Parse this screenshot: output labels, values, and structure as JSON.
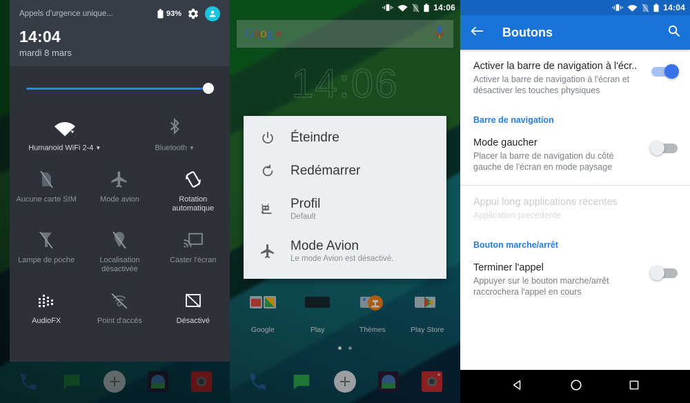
{
  "left_panel": {
    "statusbar": {
      "carrier": "Appels d'urgence unique...",
      "battery_pct": "93%"
    },
    "icons": {
      "battery": "battery-icon",
      "settings": "gear-icon",
      "avatar": "user-avatar-icon"
    },
    "clock": "14:04",
    "date": "mardi 8 mars",
    "brightness": {
      "name": "brightness-slider",
      "value": 100
    },
    "tiles": [
      {
        "label": "Humanoid WiFi 2-4",
        "icon": "wifi-icon",
        "active": true,
        "caret": true
      },
      {
        "label": "Bluetooth",
        "icon": "bluetooth-icon",
        "active": false,
        "caret": true
      },
      {
        "label": "Aucune carte SIM",
        "icon": "no-sim-icon",
        "active": false,
        "caret": false
      },
      {
        "label": "Mode avion",
        "icon": "airplane-icon",
        "active": false,
        "caret": false
      },
      {
        "label": "Rotation automatique",
        "icon": "auto-rotate-icon",
        "active": true,
        "caret": false
      },
      {
        "label": "Lampe de poche",
        "icon": "flashlight-off-icon",
        "active": false,
        "caret": false
      },
      {
        "label": "Localisation désactivée",
        "icon": "location-off-icon",
        "active": false,
        "caret": false
      },
      {
        "label": "Caster l'écran",
        "icon": "cast-icon",
        "active": false,
        "caret": false
      },
      {
        "label": "AudioFX",
        "icon": "equalizer-icon",
        "active": true,
        "caret": false
      },
      {
        "label": "Point d'accès",
        "icon": "hotspot-off-icon",
        "active": false,
        "caret": false
      },
      {
        "label": "Désactivé",
        "icon": "sync-off-icon",
        "active": true,
        "caret": false
      }
    ],
    "dock": [
      {
        "name": "phone-icon"
      },
      {
        "name": "messaging-icon"
      },
      {
        "name": "app-drawer-icon"
      },
      {
        "name": "gallery-icon"
      },
      {
        "name": "camera-icon"
      }
    ]
  },
  "mid_panel": {
    "statusbar": {
      "time": "14:06"
    },
    "search": {
      "logo": "Google",
      "mic": "microphone-icon"
    },
    "clock_widget": "14:06",
    "apps": [
      {
        "label": "Google",
        "icon": "google-folder-icon"
      },
      {
        "label": "Play",
        "icon": "play-folder-icon"
      },
      {
        "label": "Thèmes",
        "icon": "themes-icon"
      },
      {
        "label": "Play Store",
        "icon": "play-store-icon"
      }
    ],
    "page_dots": {
      "count": 2,
      "active_index": 0
    },
    "power_dialog": [
      {
        "title": "Éteindre",
        "sub": "",
        "icon": "power-icon"
      },
      {
        "title": "Redémarrer",
        "sub": "",
        "icon": "restart-icon"
      },
      {
        "title": "Profil",
        "sub": "Default",
        "icon": "cyanogenmod-icon"
      },
      {
        "title": "Mode Avion",
        "sub": "Le mode Avion est désactivé.",
        "icon": "airplane-icon"
      }
    ],
    "dock": [
      {
        "name": "phone-icon"
      },
      {
        "name": "messaging-icon"
      },
      {
        "name": "app-drawer-icon"
      },
      {
        "name": "gallery-icon"
      },
      {
        "name": "camera-icon"
      }
    ]
  },
  "right_panel": {
    "statusbar": {
      "time": "14:04"
    },
    "appbar": {
      "back": "back-arrow-icon",
      "title": "Boutons",
      "search": "search-icon"
    },
    "prefs": [
      {
        "title": "Activer la barre de navigation à l'écr..",
        "sum": "Activer la barre de navigation à l'écran et désactiver les touches physiques",
        "switch": "on",
        "disabled": false,
        "has_switch": true
      },
      {
        "title": "Mode gaucher",
        "sum": "Placer la barre de navigation du côté gauche de l'écran en mode paysage",
        "switch": "off",
        "disabled": false,
        "has_switch": true
      },
      {
        "title": "Appui long applications récentes",
        "sum": "Application précédente",
        "switch": "",
        "disabled": true,
        "has_switch": false
      },
      {
        "title": "Terminer l'appel",
        "sum": "Appuyer sur le bouton marche/arrêt raccrochera l'appel en cours",
        "switch": "off",
        "disabled": false,
        "has_switch": true
      }
    ],
    "categories": {
      "nav": "Barre de navigation",
      "power": "Bouton marche/arrêt"
    },
    "navbar": [
      {
        "name": "nav-back-icon"
      },
      {
        "name": "nav-home-icon"
      },
      {
        "name": "nav-recents-icon"
      }
    ]
  },
  "colors": {
    "accent_blue": "#1a73d8",
    "switch_on": "#3a73e8",
    "category_blue": "#2a7de1",
    "shade_bg": "#2c313a",
    "shade_header": "#373d47",
    "avatar_cyan": "#18c5dd",
    "slider_blue": "#2f7ff0"
  }
}
